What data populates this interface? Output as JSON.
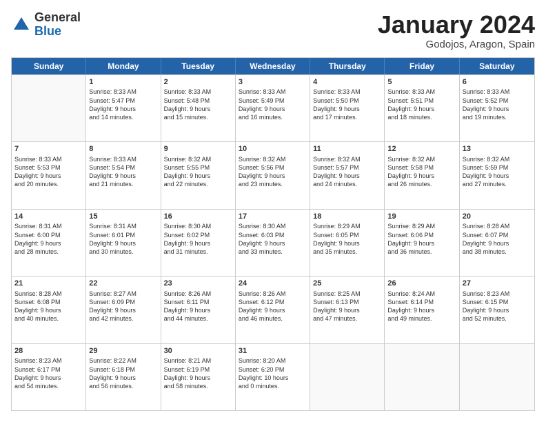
{
  "logo": {
    "general": "General",
    "blue": "Blue"
  },
  "title": "January 2024",
  "subtitle": "Godojos, Aragon, Spain",
  "days": [
    "Sunday",
    "Monday",
    "Tuesday",
    "Wednesday",
    "Thursday",
    "Friday",
    "Saturday"
  ],
  "weeks": [
    [
      {
        "day": "",
        "sunrise": "",
        "sunset": "",
        "daylight": ""
      },
      {
        "day": "1",
        "sunrise": "Sunrise: 8:33 AM",
        "sunset": "Sunset: 5:47 PM",
        "daylight": "Daylight: 9 hours",
        "daylight2": "and 14 minutes."
      },
      {
        "day": "2",
        "sunrise": "Sunrise: 8:33 AM",
        "sunset": "Sunset: 5:48 PM",
        "daylight": "Daylight: 9 hours",
        "daylight2": "and 15 minutes."
      },
      {
        "day": "3",
        "sunrise": "Sunrise: 8:33 AM",
        "sunset": "Sunset: 5:49 PM",
        "daylight": "Daylight: 9 hours",
        "daylight2": "and 16 minutes."
      },
      {
        "day": "4",
        "sunrise": "Sunrise: 8:33 AM",
        "sunset": "Sunset: 5:50 PM",
        "daylight": "Daylight: 9 hours",
        "daylight2": "and 17 minutes."
      },
      {
        "day": "5",
        "sunrise": "Sunrise: 8:33 AM",
        "sunset": "Sunset: 5:51 PM",
        "daylight": "Daylight: 9 hours",
        "daylight2": "and 18 minutes."
      },
      {
        "day": "6",
        "sunrise": "Sunrise: 8:33 AM",
        "sunset": "Sunset: 5:52 PM",
        "daylight": "Daylight: 9 hours",
        "daylight2": "and 19 minutes."
      }
    ],
    [
      {
        "day": "7",
        "sunrise": "Sunrise: 8:33 AM",
        "sunset": "Sunset: 5:53 PM",
        "daylight": "Daylight: 9 hours",
        "daylight2": "and 20 minutes."
      },
      {
        "day": "8",
        "sunrise": "Sunrise: 8:33 AM",
        "sunset": "Sunset: 5:54 PM",
        "daylight": "Daylight: 9 hours",
        "daylight2": "and 21 minutes."
      },
      {
        "day": "9",
        "sunrise": "Sunrise: 8:32 AM",
        "sunset": "Sunset: 5:55 PM",
        "daylight": "Daylight: 9 hours",
        "daylight2": "and 22 minutes."
      },
      {
        "day": "10",
        "sunrise": "Sunrise: 8:32 AM",
        "sunset": "Sunset: 5:56 PM",
        "daylight": "Daylight: 9 hours",
        "daylight2": "and 23 minutes."
      },
      {
        "day": "11",
        "sunrise": "Sunrise: 8:32 AM",
        "sunset": "Sunset: 5:57 PM",
        "daylight": "Daylight: 9 hours",
        "daylight2": "and 24 minutes."
      },
      {
        "day": "12",
        "sunrise": "Sunrise: 8:32 AM",
        "sunset": "Sunset: 5:58 PM",
        "daylight": "Daylight: 9 hours",
        "daylight2": "and 26 minutes."
      },
      {
        "day": "13",
        "sunrise": "Sunrise: 8:32 AM",
        "sunset": "Sunset: 5:59 PM",
        "daylight": "Daylight: 9 hours",
        "daylight2": "and 27 minutes."
      }
    ],
    [
      {
        "day": "14",
        "sunrise": "Sunrise: 8:31 AM",
        "sunset": "Sunset: 6:00 PM",
        "daylight": "Daylight: 9 hours",
        "daylight2": "and 28 minutes."
      },
      {
        "day": "15",
        "sunrise": "Sunrise: 8:31 AM",
        "sunset": "Sunset: 6:01 PM",
        "daylight": "Daylight: 9 hours",
        "daylight2": "and 30 minutes."
      },
      {
        "day": "16",
        "sunrise": "Sunrise: 8:30 AM",
        "sunset": "Sunset: 6:02 PM",
        "daylight": "Daylight: 9 hours",
        "daylight2": "and 31 minutes."
      },
      {
        "day": "17",
        "sunrise": "Sunrise: 8:30 AM",
        "sunset": "Sunset: 6:03 PM",
        "daylight": "Daylight: 9 hours",
        "daylight2": "and 33 minutes."
      },
      {
        "day": "18",
        "sunrise": "Sunrise: 8:29 AM",
        "sunset": "Sunset: 6:05 PM",
        "daylight": "Daylight: 9 hours",
        "daylight2": "and 35 minutes."
      },
      {
        "day": "19",
        "sunrise": "Sunrise: 8:29 AM",
        "sunset": "Sunset: 6:06 PM",
        "daylight": "Daylight: 9 hours",
        "daylight2": "and 36 minutes."
      },
      {
        "day": "20",
        "sunrise": "Sunrise: 8:28 AM",
        "sunset": "Sunset: 6:07 PM",
        "daylight": "Daylight: 9 hours",
        "daylight2": "and 38 minutes."
      }
    ],
    [
      {
        "day": "21",
        "sunrise": "Sunrise: 8:28 AM",
        "sunset": "Sunset: 6:08 PM",
        "daylight": "Daylight: 9 hours",
        "daylight2": "and 40 minutes."
      },
      {
        "day": "22",
        "sunrise": "Sunrise: 8:27 AM",
        "sunset": "Sunset: 6:09 PM",
        "daylight": "Daylight: 9 hours",
        "daylight2": "and 42 minutes."
      },
      {
        "day": "23",
        "sunrise": "Sunrise: 8:26 AM",
        "sunset": "Sunset: 6:11 PM",
        "daylight": "Daylight: 9 hours",
        "daylight2": "and 44 minutes."
      },
      {
        "day": "24",
        "sunrise": "Sunrise: 8:26 AM",
        "sunset": "Sunset: 6:12 PM",
        "daylight": "Daylight: 9 hours",
        "daylight2": "and 46 minutes."
      },
      {
        "day": "25",
        "sunrise": "Sunrise: 8:25 AM",
        "sunset": "Sunset: 6:13 PM",
        "daylight": "Daylight: 9 hours",
        "daylight2": "and 47 minutes."
      },
      {
        "day": "26",
        "sunrise": "Sunrise: 8:24 AM",
        "sunset": "Sunset: 6:14 PM",
        "daylight": "Daylight: 9 hours",
        "daylight2": "and 49 minutes."
      },
      {
        "day": "27",
        "sunrise": "Sunrise: 8:23 AM",
        "sunset": "Sunset: 6:15 PM",
        "daylight": "Daylight: 9 hours",
        "daylight2": "and 52 minutes."
      }
    ],
    [
      {
        "day": "28",
        "sunrise": "Sunrise: 8:23 AM",
        "sunset": "Sunset: 6:17 PM",
        "daylight": "Daylight: 9 hours",
        "daylight2": "and 54 minutes."
      },
      {
        "day": "29",
        "sunrise": "Sunrise: 8:22 AM",
        "sunset": "Sunset: 6:18 PM",
        "daylight": "Daylight: 9 hours",
        "daylight2": "and 56 minutes."
      },
      {
        "day": "30",
        "sunrise": "Sunrise: 8:21 AM",
        "sunset": "Sunset: 6:19 PM",
        "daylight": "Daylight: 9 hours",
        "daylight2": "and 58 minutes."
      },
      {
        "day": "31",
        "sunrise": "Sunrise: 8:20 AM",
        "sunset": "Sunset: 6:20 PM",
        "daylight": "Daylight: 10 hours",
        "daylight2": "and 0 minutes."
      },
      {
        "day": "",
        "sunrise": "",
        "sunset": "",
        "daylight": "",
        "daylight2": ""
      },
      {
        "day": "",
        "sunrise": "",
        "sunset": "",
        "daylight": "",
        "daylight2": ""
      },
      {
        "day": "",
        "sunrise": "",
        "sunset": "",
        "daylight": "",
        "daylight2": ""
      }
    ]
  ]
}
